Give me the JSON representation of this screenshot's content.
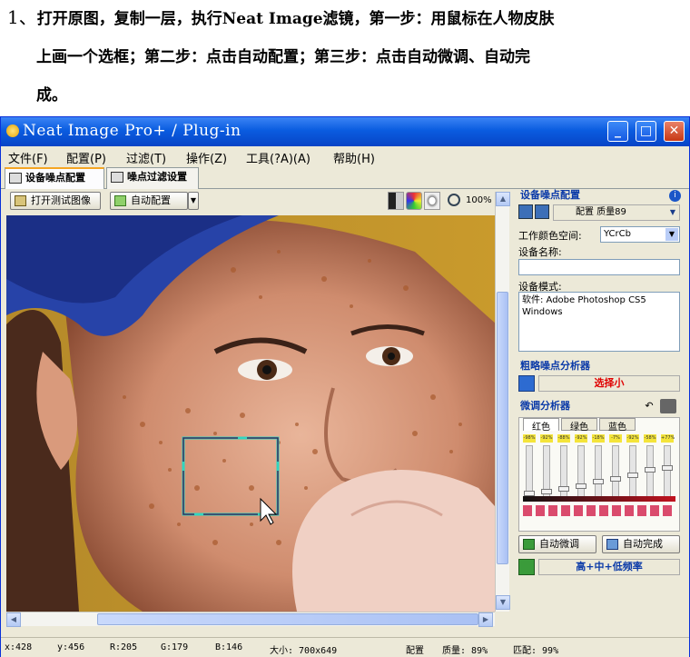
{
  "instruction": {
    "number": "1、",
    "line1": "打开原图，复制一层，执行Neat Image滤镜，第一步：用鼠标在人物皮肤",
    "line2": "上画一个选框；第二步：点击自动配置；第三步：点击自动微调、自动完",
    "line3": "成。"
  },
  "window": {
    "title": "Neat Image Pro+ / Plug-in",
    "min_label": "_",
    "max_label": "□",
    "close_label": "✕"
  },
  "menu": [
    "文件(F)",
    "配置(P)",
    "过滤(T)",
    "操作(Z)",
    "工具(?A)(A)",
    "帮助(H)"
  ],
  "tabs": [
    {
      "label": "设备噪点配置",
      "active": true
    },
    {
      "label": "噪点过滤设置",
      "active": false
    }
  ],
  "toolbar": {
    "open_button": "打开测试图像",
    "auto_profile_button": "自动配置",
    "zoom": "100%"
  },
  "right_panel": {
    "profile_header": "设备噪点配置",
    "profile_value": "配置 质量89",
    "color_space_label": "工作颜色空间:",
    "color_space_value": "YCrCb",
    "device_name_label": "设备名称:",
    "device_name_value": "",
    "device_mode_label": "设备模式:",
    "device_mode_value": "软件: Adobe Photoshop CS5 Windows",
    "coarse_header": "粗略噪点分析器",
    "coarse_select": "选择小",
    "fine_header": "微调分析器",
    "channel_tabs": [
      "红色",
      "绿色",
      "蓝色"
    ],
    "slider_labels": [
      "-98%",
      "-92%",
      "-88%",
      "-92%",
      "-18%",
      "-7%",
      "-92%",
      "-58%",
      "+77%"
    ],
    "slider_levels": [
      0.05,
      0.1,
      0.16,
      0.22,
      0.3,
      0.36,
      0.44,
      0.56,
      0.6
    ],
    "auto_fine_button": "自动微调",
    "auto_complete_button": "自动完成",
    "freq_label": "高+中+低频率"
  },
  "status": {
    "x": "x:428",
    "y": "y:456",
    "r": "R:205",
    "g": "G:179",
    "b": "B:146",
    "size": "大小: 700x649",
    "profile": "配置",
    "quality": "质量: 89%",
    "match": "匹配: 99%"
  },
  "colors": {
    "accent": "#0b3aa8",
    "error_red": "#e00000",
    "titlebar": "#0a5ce0"
  }
}
